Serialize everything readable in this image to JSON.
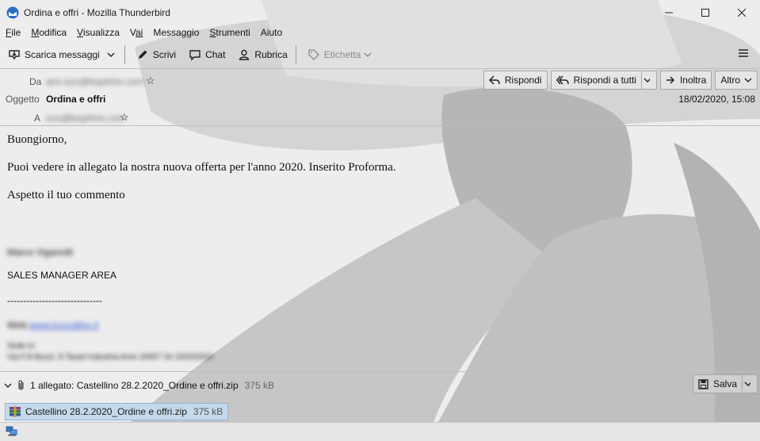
{
  "window": {
    "title": "Ordina e offri - Mozilla Thunderbird"
  },
  "menu": {
    "items": [
      {
        "first": "F",
        "rest": "ile"
      },
      {
        "first": "M",
        "rest": "odifica"
      },
      {
        "first": "V",
        "rest": "isualizza"
      },
      {
        "first": "V",
        "rest": "ai"
      },
      {
        "first": "M",
        "rest": "essaggio"
      },
      {
        "first": "S",
        "rest": "trumenti"
      },
      {
        "first": "Ai",
        "rest": "uto"
      }
    ]
  },
  "toolbar": {
    "get_messages": "Scarica messaggi",
    "write": "Scrivi",
    "chat": "Chat",
    "address_book": "Rubrica",
    "tag": "Etichetta"
  },
  "header": {
    "from_label": "Da",
    "from_value": "ann.iurs@keplrhm.com",
    "subject_label": "Oggetto",
    "subject_value": "Ordina e offri",
    "to_label": "A",
    "to_value": "iurs@keplrhm.com",
    "date": "18/02/2020, 15:08",
    "reply": "Rispondi",
    "reply_all": "Rispondi a tutti",
    "forward": "Inoltra",
    "more": "Altro"
  },
  "body": {
    "greeting": "Buongiorno,",
    "line1": "Puoi vedere in allegato la nostra nuova offerta per l'anno 2020. Inserito Proforma.",
    "line2": "Aspetto il tuo commento",
    "signature_name": "Marco Viganotti",
    "role": "SALES MANAGER AREA",
    "separator": "------------------------------",
    "web_label": "Web:",
    "web_link": "www.trsvndthe.it",
    "addr_label": "Sede in:",
    "addr_value": "Via F.Ili Bozzi, 8 Tavarl Industria Aree 20057 Sri 2020/2020"
  },
  "attachment": {
    "summary": "1 allegato: Castellino 28.2.2020_Ordine e offri.zip",
    "size": "375 kB",
    "save": "Salva",
    "file_name": "Castellino 28.2.2020_Ordine e offri.zip",
    "file_size": "375 kB"
  }
}
